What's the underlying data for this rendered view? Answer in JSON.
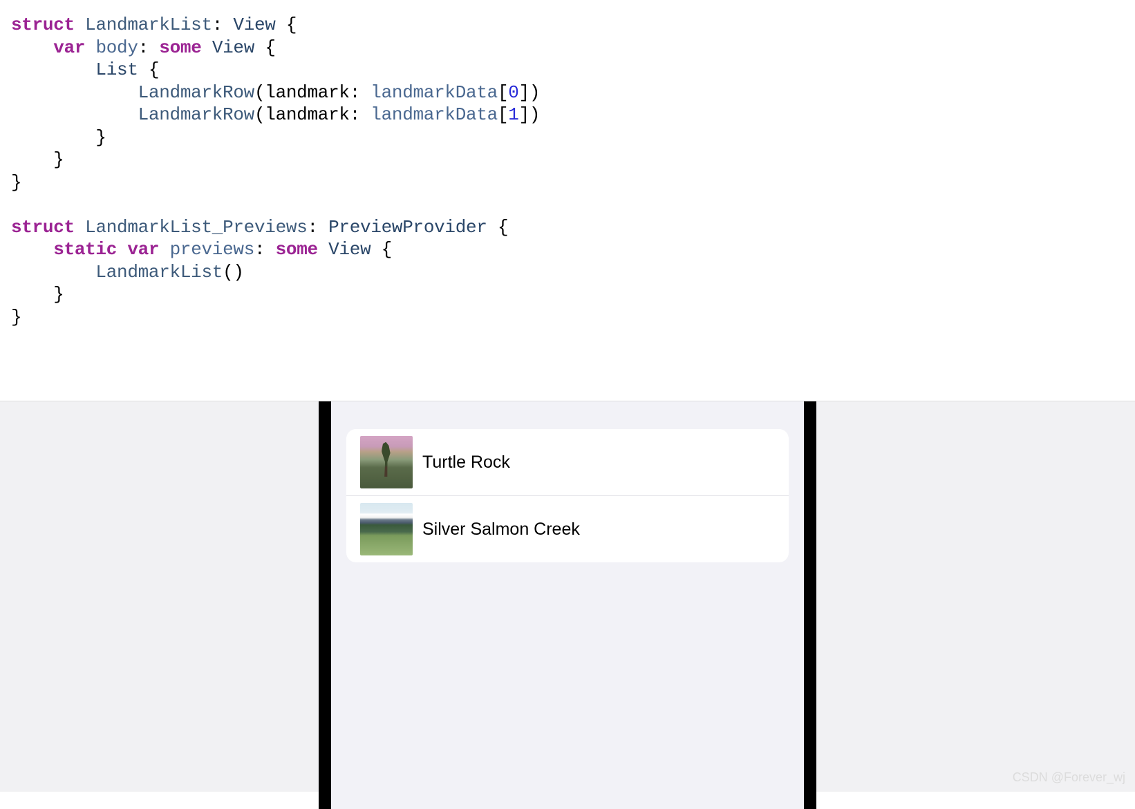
{
  "code": {
    "tokens": [
      {
        "c": "kw",
        "t": "struct"
      },
      {
        "c": "",
        "t": " "
      },
      {
        "c": "usertype",
        "t": "LandmarkList"
      },
      {
        "c": "",
        "t": ": "
      },
      {
        "c": "type",
        "t": "View"
      },
      {
        "c": "",
        "t": " {\n"
      },
      {
        "c": "",
        "t": "    "
      },
      {
        "c": "kw",
        "t": "var"
      },
      {
        "c": "",
        "t": " "
      },
      {
        "c": "prop",
        "t": "body"
      },
      {
        "c": "",
        "t": ": "
      },
      {
        "c": "kw",
        "t": "some"
      },
      {
        "c": "",
        "t": " "
      },
      {
        "c": "type",
        "t": "View"
      },
      {
        "c": "",
        "t": " {\n"
      },
      {
        "c": "",
        "t": "        "
      },
      {
        "c": "type",
        "t": "List"
      },
      {
        "c": "",
        "t": " {\n"
      },
      {
        "c": "",
        "t": "            "
      },
      {
        "c": "usertype",
        "t": "LandmarkRow"
      },
      {
        "c": "",
        "t": "(landmark: "
      },
      {
        "c": "prop",
        "t": "landmarkData"
      },
      {
        "c": "",
        "t": "["
      },
      {
        "c": "num",
        "t": "0"
      },
      {
        "c": "",
        "t": "])\n"
      },
      {
        "c": "",
        "t": "            "
      },
      {
        "c": "usertype",
        "t": "LandmarkRow"
      },
      {
        "c": "",
        "t": "(landmark: "
      },
      {
        "c": "prop",
        "t": "landmarkData"
      },
      {
        "c": "",
        "t": "["
      },
      {
        "c": "num",
        "t": "1"
      },
      {
        "c": "",
        "t": "])\n"
      },
      {
        "c": "",
        "t": "        }\n"
      },
      {
        "c": "",
        "t": "    }\n"
      },
      {
        "c": "",
        "t": "}\n"
      },
      {
        "c": "",
        "t": "\n"
      },
      {
        "c": "kw",
        "t": "struct"
      },
      {
        "c": "",
        "t": " "
      },
      {
        "c": "usertype",
        "t": "LandmarkList_Previews"
      },
      {
        "c": "",
        "t": ": "
      },
      {
        "c": "type",
        "t": "PreviewProvider"
      },
      {
        "c": "",
        "t": " {\n"
      },
      {
        "c": "",
        "t": "    "
      },
      {
        "c": "kw",
        "t": "static"
      },
      {
        "c": "",
        "t": " "
      },
      {
        "c": "kw",
        "t": "var"
      },
      {
        "c": "",
        "t": " "
      },
      {
        "c": "prop",
        "t": "previews"
      },
      {
        "c": "",
        "t": ": "
      },
      {
        "c": "kw",
        "t": "some"
      },
      {
        "c": "",
        "t": " "
      },
      {
        "c": "type",
        "t": "View"
      },
      {
        "c": "",
        "t": " {\n"
      },
      {
        "c": "",
        "t": "        "
      },
      {
        "c": "usertype",
        "t": "LandmarkList"
      },
      {
        "c": "",
        "t": "()\n"
      },
      {
        "c": "",
        "t": "    }\n"
      },
      {
        "c": "",
        "t": "}\n"
      }
    ]
  },
  "preview": {
    "rows": [
      {
        "label": "Turtle Rock",
        "imgClass": "img-turtle"
      },
      {
        "label": "Silver Salmon Creek",
        "imgClass": "img-salmon"
      }
    ]
  },
  "watermark": "CSDN @Forever_wj"
}
